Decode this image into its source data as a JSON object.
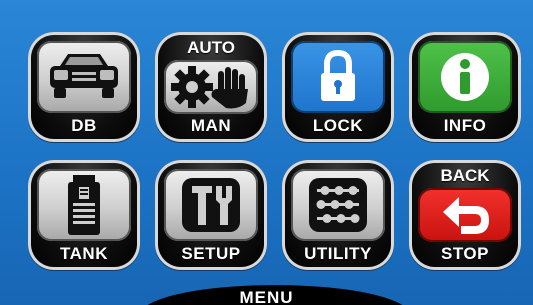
{
  "tiles": {
    "db": {
      "label": "DB",
      "icon": "car-icon"
    },
    "man": {
      "top_label": "AUTO",
      "label": "MAN",
      "icon": "gear-hand-icon"
    },
    "lock": {
      "label": "LOCK",
      "icon": "padlock-icon"
    },
    "info": {
      "label": "INFO",
      "icon": "info-icon"
    },
    "tank": {
      "label": "TANK",
      "icon": "tank-icon"
    },
    "setup": {
      "label": "SETUP",
      "icon": "tools-icon"
    },
    "utility": {
      "label": "UTILITY",
      "icon": "sliders-icon"
    },
    "stop": {
      "top_label": "BACK",
      "label": "STOP",
      "icon": "back-arrow-icon"
    }
  },
  "footer": {
    "label": "MENU"
  },
  "colors": {
    "background": "#1f77c8",
    "lock_panel": "#1f74cc",
    "info_panel": "#2f9a2d",
    "stop_panel": "#c8120e"
  }
}
